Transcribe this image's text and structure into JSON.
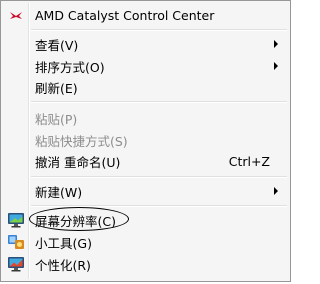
{
  "menu": {
    "items": [
      {
        "label": "AMD Catalyst Control Center",
        "icon": "amd-catalyst-icon",
        "disabled": false
      },
      {
        "label": "查看(V)",
        "submenu": true,
        "disabled": false
      },
      {
        "label": "排序方式(O)",
        "submenu": true,
        "disabled": false
      },
      {
        "label": "刷新(E)",
        "disabled": false
      },
      {
        "label": "粘贴(P)",
        "disabled": true
      },
      {
        "label": "粘贴快捷方式(S)",
        "disabled": true
      },
      {
        "label": "撤消 重命名(U)",
        "shortcut": "Ctrl+Z",
        "disabled": false
      },
      {
        "label": "新建(W)",
        "submenu": true,
        "disabled": false
      },
      {
        "label": "屏幕分辨率(C)",
        "icon": "screen-resolution-icon",
        "disabled": false,
        "highlighted_by_circle": true
      },
      {
        "label": "小工具(G)",
        "icon": "gadgets-icon",
        "disabled": false
      },
      {
        "label": "个性化(R)",
        "icon": "personalize-icon",
        "disabled": false
      }
    ]
  },
  "colors": {
    "menu_background": "#f5f5f5",
    "disabled_text": "#8d8d8d",
    "amd_red": "#c8102e"
  }
}
